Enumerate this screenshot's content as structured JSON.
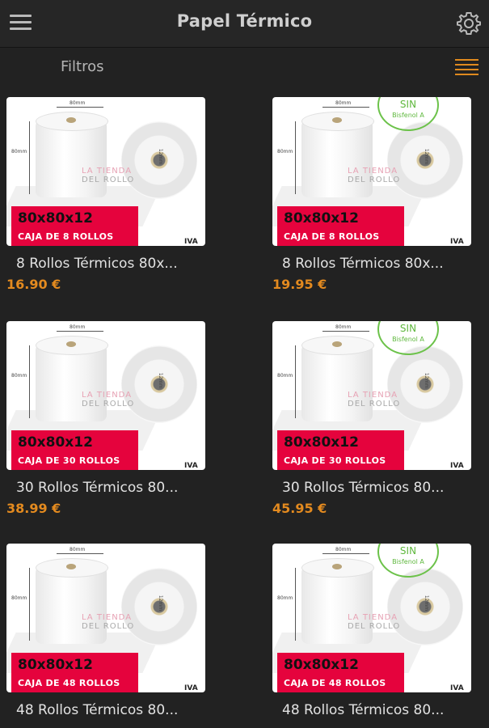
{
  "header": {
    "title": "Papel Térmico",
    "menu_icon": "hamburger-menu-icon",
    "settings_icon": "gear-icon"
  },
  "filters": {
    "label": "Filtros",
    "view_icon": "list-view-icon",
    "accent": "#e08a1e"
  },
  "colors": {
    "background": "#222222",
    "price": "#e38a1f",
    "promo_band": "#e5033d",
    "badge_green": "#6cc24a"
  },
  "products": [
    {
      "name": "8 Rollos Térmicos 80x...",
      "price": "16.90 €",
      "image": {
        "size": "80x80x12",
        "box": "CAJA DE 8 ROLLOS",
        "dim_width": "80mm",
        "dim_height": "80mm",
        "dim_core": "12mm",
        "watermark_1": "LA TIENDA",
        "watermark_2": "DEL ROLLO",
        "tax": "IVA"
      }
    },
    {
      "name": "8 Rollos Térmicos 80x...",
      "price": "19.95 €",
      "image": {
        "size": "80x80x12",
        "box": "CAJA DE 8 ROLLOS",
        "dim_width": "80mm",
        "dim_height": "80mm",
        "dim_core": "12mm",
        "watermark_1": "LA TIENDA",
        "watermark_2": "DEL ROLLO",
        "tax": "IVA",
        "badge_1": "SIN",
        "badge_2": "Bisfenol A"
      }
    },
    {
      "name": "30 Rollos Térmicos 80...",
      "price": "38.99 €",
      "image": {
        "size": "80x80x12",
        "box": "CAJA DE 30 ROLLOS",
        "dim_width": "80mm",
        "dim_height": "80mm",
        "dim_core": "12mm",
        "watermark_1": "LA TIENDA",
        "watermark_2": "DEL ROLLO",
        "tax": "IVA"
      }
    },
    {
      "name": "30 Rollos Térmicos 80...",
      "price": "45.95 €",
      "image": {
        "size": "80x80x12",
        "box": "CAJA DE 30 ROLLOS",
        "dim_width": "80mm",
        "dim_height": "80mm",
        "dim_core": "12mm",
        "watermark_1": "LA TIENDA",
        "watermark_2": "DEL ROLLO",
        "tax": "IVA",
        "badge_1": "SIN",
        "badge_2": "Bisfenol A"
      }
    },
    {
      "name": "48 Rollos Térmicos 80...",
      "price": "",
      "image": {
        "size": "80x80x12",
        "box": "CAJA DE 48 ROLLOS",
        "dim_width": "80mm",
        "dim_height": "80mm",
        "dim_core": "12mm",
        "watermark_1": "LA TIENDA",
        "watermark_2": "DEL ROLLO",
        "tax": "IVA"
      }
    },
    {
      "name": "48 Rollos Térmicos 80...",
      "price": "",
      "image": {
        "size": "80x80x12",
        "box": "CAJA DE 48 ROLLOS",
        "dim_width": "80mm",
        "dim_height": "80mm",
        "dim_core": "12mm",
        "watermark_1": "LA TIENDA",
        "watermark_2": "DEL ROLLO",
        "tax": "IVA",
        "badge_1": "SIN",
        "badge_2": "Bisfenol A"
      }
    }
  ]
}
